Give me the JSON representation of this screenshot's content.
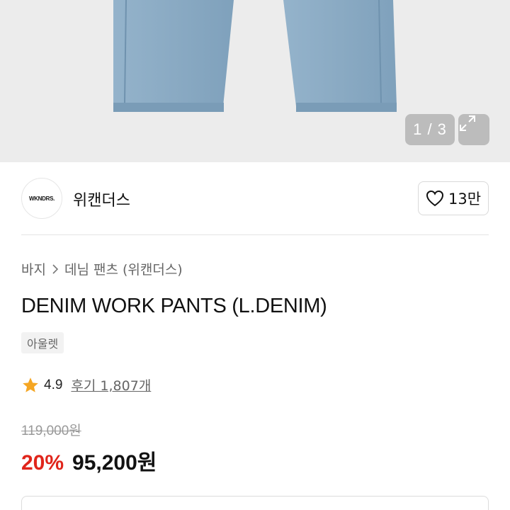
{
  "colors": {
    "accent_red": "#e0251b",
    "star": "#f5a623",
    "denim": "#8fb0c9",
    "hero_bg": "#ececec"
  },
  "gallery": {
    "pager": "1 / 3",
    "expand_icon": "expand-icon"
  },
  "shop": {
    "logo_text": "WKNDRS.",
    "name": "위캔더스",
    "like_count": "13만",
    "like_icon": "heart-icon"
  },
  "breadcrumb": {
    "category": "바지",
    "subcategory": "데님 팬츠 (위캔더스)"
  },
  "product": {
    "title": "DENIM WORK PANTS (L.DENIM)",
    "tag": "아울렛",
    "rating": "4.9",
    "reviews": "후기 1,807개",
    "original_price": "119,000원",
    "discount": "20%",
    "price": "95,200원"
  }
}
